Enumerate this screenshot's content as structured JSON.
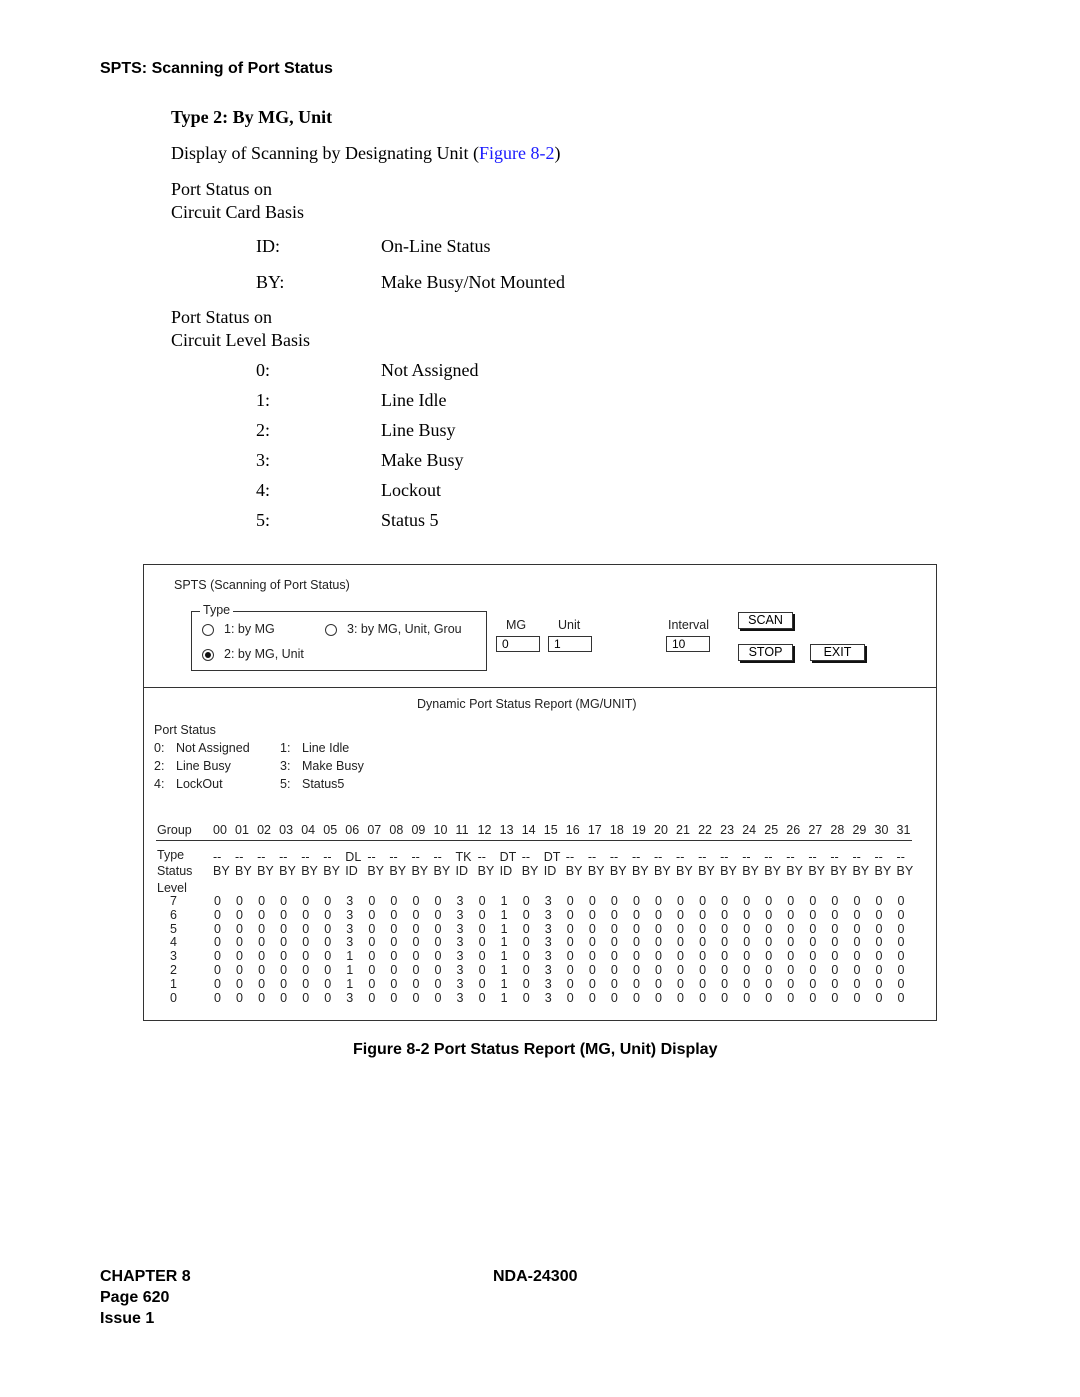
{
  "section_heading": "SPTS:  Scanning of Port Status",
  "subheading": "Type 2: By MG, Unit",
  "intro": {
    "text": "Display of Scanning by Designating Unit (",
    "link": "Figure 8-2",
    "suffix": ")"
  },
  "card_basis": {
    "title_line1": "Port Status on",
    "title_line2": "Circuit Card Basis",
    "items": [
      {
        "code": "ID:",
        "desc": "On-Line Status"
      },
      {
        "code": "BY:",
        "desc": "Make Busy/Not Mounted"
      }
    ]
  },
  "level_basis": {
    "title_line1": "Port Status on",
    "title_line2": "Circuit Level Basis",
    "items": [
      {
        "code": "0:",
        "desc": "Not Assigned"
      },
      {
        "code": "1:",
        "desc": "Line Idle"
      },
      {
        "code": "2:",
        "desc": "Line Busy"
      },
      {
        "code": "3:",
        "desc": "Make Busy"
      },
      {
        "code": "4:",
        "desc": "Lockout"
      },
      {
        "code": "5:",
        "desc": "Status 5"
      }
    ]
  },
  "screen": {
    "title": "SPTS (Scanning of Port Status)",
    "type_group": {
      "legend": "Type",
      "options": [
        {
          "label": "1: by MG",
          "selected": false
        },
        {
          "label": "3: by MG, Unit, Grou",
          "selected": false
        },
        {
          "label": "2: by MG, Unit",
          "selected": true
        }
      ]
    },
    "mg": {
      "label": "MG",
      "value": "0"
    },
    "unit": {
      "label": "Unit",
      "value": "1"
    },
    "interval": {
      "label": "Interval",
      "value": "10"
    },
    "buttons": {
      "scan": "SCAN",
      "stop": "STOP",
      "exit": "EXIT"
    },
    "report_title": "Dynamic Port Status Report (MG/UNIT)",
    "legend_title": "Port Status",
    "legend_items": [
      {
        "code": "0:",
        "label": "Not Assigned"
      },
      {
        "code": "1:",
        "label": "Line Idle"
      },
      {
        "code": "2:",
        "label": "Line Busy"
      },
      {
        "code": "3:",
        "label": "Make Busy"
      },
      {
        "code": "4:",
        "label": "LockOut"
      },
      {
        "code": "5:",
        "label": "Status5"
      }
    ],
    "table": {
      "group_label": "Group",
      "type_label": "Type",
      "status_label": "Status",
      "level_label": "Level",
      "groups": [
        "00",
        "01",
        "02",
        "03",
        "04",
        "05",
        "06",
        "07",
        "08",
        "09",
        "10",
        "11",
        "12",
        "13",
        "14",
        "15",
        "16",
        "17",
        "18",
        "19",
        "20",
        "21",
        "22",
        "23",
        "24",
        "25",
        "26",
        "27",
        "28",
        "29",
        "30",
        "31"
      ],
      "types": [
        "--",
        "--",
        "--",
        "--",
        "--",
        "--",
        "DL",
        "--",
        "--",
        "--",
        "--",
        "TK",
        "--",
        "DT",
        "--",
        "DT",
        "--",
        "--",
        "--",
        "--",
        "--",
        "--",
        "--",
        "--",
        "--",
        "--",
        "--",
        "--",
        "--",
        "--",
        "--",
        "--"
      ],
      "statuses": [
        "BY",
        "BY",
        "BY",
        "BY",
        "BY",
        "BY",
        "ID",
        "BY",
        "BY",
        "BY",
        "BY",
        "ID",
        "BY",
        "ID",
        "BY",
        "ID",
        "BY",
        "BY",
        "BY",
        "BY",
        "BY",
        "BY",
        "BY",
        "BY",
        "BY",
        "BY",
        "BY",
        "BY",
        "BY",
        "BY",
        "BY",
        "BY"
      ],
      "levels": [
        {
          "level": "7",
          "values": [
            "0",
            "0",
            "0",
            "0",
            "0",
            "0",
            "3",
            "0",
            "0",
            "0",
            "0",
            "3",
            "0",
            "1",
            "0",
            "3",
            "0",
            "0",
            "0",
            "0",
            "0",
            "0",
            "0",
            "0",
            "0",
            "0",
            "0",
            "0",
            "0",
            "0",
            "0",
            "0"
          ]
        },
        {
          "level": "6",
          "values": [
            "0",
            "0",
            "0",
            "0",
            "0",
            "0",
            "3",
            "0",
            "0",
            "0",
            "0",
            "3",
            "0",
            "1",
            "0",
            "3",
            "0",
            "0",
            "0",
            "0",
            "0",
            "0",
            "0",
            "0",
            "0",
            "0",
            "0",
            "0",
            "0",
            "0",
            "0",
            "0"
          ]
        },
        {
          "level": "5",
          "values": [
            "0",
            "0",
            "0",
            "0",
            "0",
            "0",
            "3",
            "0",
            "0",
            "0",
            "0",
            "3",
            "0",
            "1",
            "0",
            "3",
            "0",
            "0",
            "0",
            "0",
            "0",
            "0",
            "0",
            "0",
            "0",
            "0",
            "0",
            "0",
            "0",
            "0",
            "0",
            "0"
          ]
        },
        {
          "level": "4",
          "values": [
            "0",
            "0",
            "0",
            "0",
            "0",
            "0",
            "3",
            "0",
            "0",
            "0",
            "0",
            "3",
            "0",
            "1",
            "0",
            "3",
            "0",
            "0",
            "0",
            "0",
            "0",
            "0",
            "0",
            "0",
            "0",
            "0",
            "0",
            "0",
            "0",
            "0",
            "0",
            "0"
          ]
        },
        {
          "level": "3",
          "values": [
            "0",
            "0",
            "0",
            "0",
            "0",
            "0",
            "1",
            "0",
            "0",
            "0",
            "0",
            "3",
            "0",
            "1",
            "0",
            "3",
            "0",
            "0",
            "0",
            "0",
            "0",
            "0",
            "0",
            "0",
            "0",
            "0",
            "0",
            "0",
            "0",
            "0",
            "0",
            "0"
          ]
        },
        {
          "level": "2",
          "values": [
            "0",
            "0",
            "0",
            "0",
            "0",
            "0",
            "1",
            "0",
            "0",
            "0",
            "0",
            "3",
            "0",
            "1",
            "0",
            "3",
            "0",
            "0",
            "0",
            "0",
            "0",
            "0",
            "0",
            "0",
            "0",
            "0",
            "0",
            "0",
            "0",
            "0",
            "0",
            "0"
          ]
        },
        {
          "level": "1",
          "values": [
            "0",
            "0",
            "0",
            "0",
            "0",
            "0",
            "1",
            "0",
            "0",
            "0",
            "0",
            "3",
            "0",
            "1",
            "0",
            "3",
            "0",
            "0",
            "0",
            "0",
            "0",
            "0",
            "0",
            "0",
            "0",
            "0",
            "0",
            "0",
            "0",
            "0",
            "0",
            "0"
          ]
        },
        {
          "level": "0",
          "values": [
            "0",
            "0",
            "0",
            "0",
            "0",
            "0",
            "3",
            "0",
            "0",
            "0",
            "0",
            "3",
            "0",
            "1",
            "0",
            "3",
            "0",
            "0",
            "0",
            "0",
            "0",
            "0",
            "0",
            "0",
            "0",
            "0",
            "0",
            "0",
            "0",
            "0",
            "0",
            "0"
          ]
        }
      ]
    }
  },
  "caption": "Figure 8-2   Port Status Report (MG, Unit) Display",
  "footer": {
    "chapter": "CHAPTER 8",
    "page": "Page 620",
    "issue": "Issue 1",
    "doc_id": "NDA-24300"
  }
}
